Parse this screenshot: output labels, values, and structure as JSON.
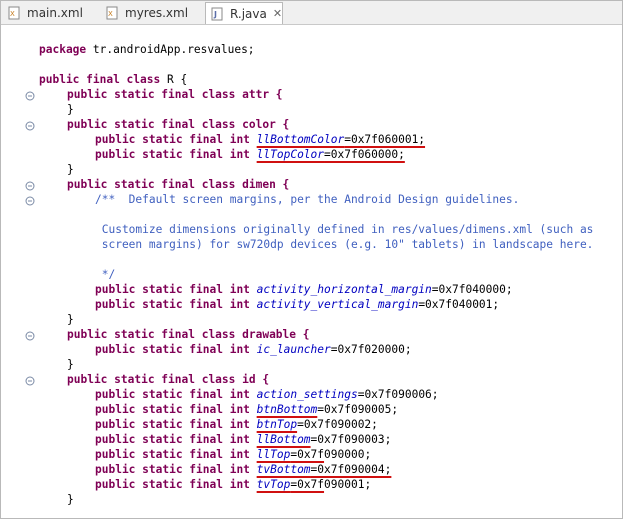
{
  "tabs": [
    {
      "label": "main.xml",
      "active": false,
      "icon": "xml-file-icon"
    },
    {
      "label": "myres.xml",
      "active": false,
      "icon": "xml-file-icon"
    },
    {
      "label": "R.java",
      "active": true,
      "icon": "java-file-icon",
      "close": "✕"
    }
  ],
  "code": {
    "package_kw": "package",
    "package_name": " tr.androidApp.resvalues;",
    "class_decl": "public final class",
    "class_name": " R {",
    "lines": {
      "attr_open": "public static final class attr {",
      "close": "}",
      "color_open": "public static final class color {",
      "field_prefix": "public static final int ",
      "llBottomColor": "llBottomColor",
      "llBottomColor_val": "=0x7f060001;",
      "llTopColor": "llTopColor",
      "llTopColor_val": "=0x7f060000;",
      "dimen_open": "public static final class dimen {",
      "comment1": "/**  Default screen margins, per the Android Design guidelines.",
      "comment2": " Customize dimensions originally defined in res/values/dimens.xml (such as",
      "comment3": " screen margins) for sw720dp devices (e.g. 10\" tablets) in landscape here.",
      "comment4": " */",
      "ahm": "activity_horizontal_margin",
      "ahm_val": "=0x7f040000;",
      "avm": "activity_vertical_margin",
      "avm_val": "=0x7f040001;",
      "drawable_open": "public static final class drawable {",
      "ic_launcher": "ic_launcher",
      "ic_launcher_val": "=0x7f020000;",
      "id_open": "public static final class id {",
      "action_settings": "action_settings",
      "action_settings_val": "=0x7f090006;",
      "btnBottom": "btnBottom",
      "btnBottom_val": "=0x7f090005;",
      "btnTop": "btnTop",
      "btnTop_val": "=0x7f090002;",
      "llBottom": "llBottom",
      "llBottom_val": "=0x7f090003;",
      "llTop": "llTop",
      "llTop_val_ul": "=0x7f",
      "llTop_val_rest": "090000;",
      "tvBottom": "tvBottom",
      "tvBottom_val": "=0x7f090004;",
      "tvTop": "tvTop",
      "tvTop_val_ul": "=0x7f",
      "tvTop_val_rest": "090001;"
    }
  },
  "colors": {
    "keyword": "#7f0055",
    "field": "#0000c0",
    "comment": "#3f5fbf",
    "highlight_underline": "#d01010"
  }
}
